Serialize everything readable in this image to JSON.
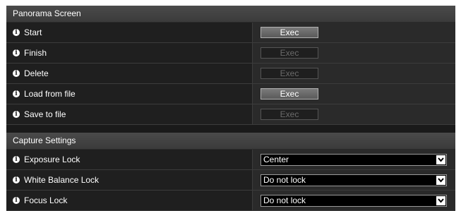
{
  "panorama": {
    "title": "Panorama Screen",
    "rows": [
      {
        "label": "Start",
        "button": "Exec",
        "enabled": true
      },
      {
        "label": "Finish",
        "button": "Exec",
        "enabled": false
      },
      {
        "label": "Delete",
        "button": "Exec",
        "enabled": false
      },
      {
        "label": "Load from file",
        "button": "Exec",
        "enabled": true
      },
      {
        "label": "Save to file",
        "button": "Exec",
        "enabled": false
      }
    ]
  },
  "capture": {
    "title": "Capture Settings",
    "rows": [
      {
        "label": "Exposure Lock",
        "value": "Center"
      },
      {
        "label": "White Balance Lock",
        "value": "Do not lock"
      },
      {
        "label": "Focus Lock",
        "value": "Do not lock"
      }
    ]
  },
  "icons": {
    "info": "info-icon",
    "dropdown": "chevron-down-icon"
  },
  "colors": {
    "background": "#1a1a1a",
    "header": "#404040",
    "text": "#ffffff"
  }
}
